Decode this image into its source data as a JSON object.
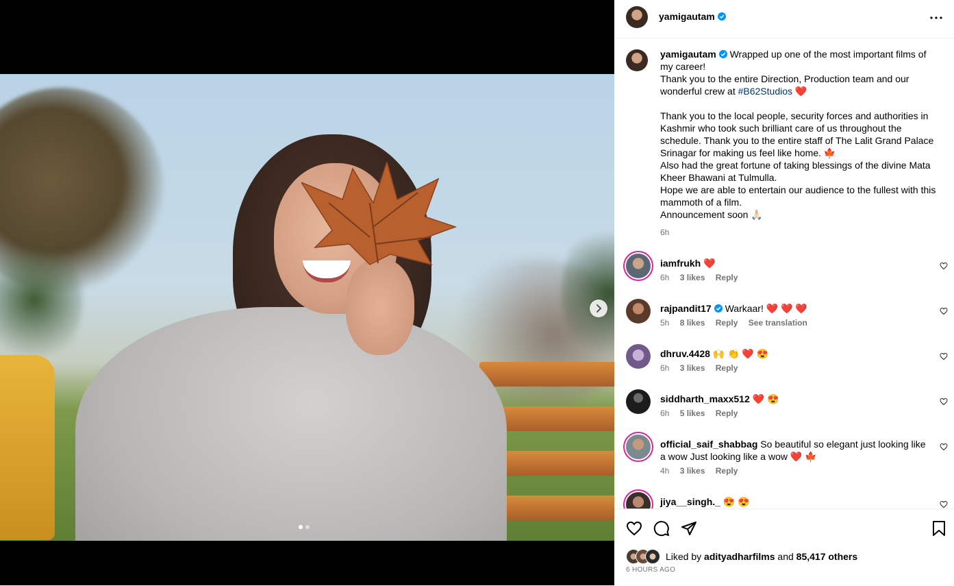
{
  "post": {
    "username": "yamigautam",
    "verified": true
  },
  "caption": {
    "username": "yamigautam",
    "line1": "Wrapped up one of the most important films of my career!",
    "line2a": "Thank you to the entire Direction, Production team and our wonderful crew at",
    "hashtag": "#B62Studios",
    "line2b": " ❤️",
    "para2": "Thank you to the local people, security forces and authorities in Kashmir who took such brilliant care of us throughout the schedule. Thank you to the entire staff of The Lalit Grand Palace Srinagar for making us feel like home. 🍁\nAlso had the great fortune of taking blessings of the divine Mata Kheer Bhawani at Tulmulla.\nHope we are able to entertain our audience to the fullest with this mammoth of a film.\nAnnouncement soon 🙏🏻",
    "age": "6h"
  },
  "comments": [
    {
      "username": "iamfrukh",
      "text": "❤️",
      "age": "6h",
      "likes": "3 likes",
      "reply": "Reply"
    },
    {
      "username": "rajpandit17",
      "text": "Warkaar! ❤️ ❤️ ❤️",
      "age": "5h",
      "likes": "8 likes",
      "reply": "Reply",
      "translate": "See translation"
    },
    {
      "username": "dhruv.4428",
      "text": "🙌 👏 ❤️ 😍",
      "age": "6h",
      "likes": "3 likes",
      "reply": "Reply"
    },
    {
      "username": "siddharth_maxx512",
      "text": "❤️ 😍",
      "age": "6h",
      "likes": "5 likes",
      "reply": "Reply"
    },
    {
      "username": "official_saif_shabbag",
      "text": "So beautiful so elegant just looking like a wow Just looking like a wow ❤️ 🍁",
      "age": "4h",
      "likes": "3 likes",
      "reply": "Reply"
    },
    {
      "username": "jiya__singh._",
      "text": "😍 😍",
      "age": "",
      "likes": "",
      "reply": ""
    }
  ],
  "likes": {
    "prefix": "Liked by ",
    "user": "adityadharfilms",
    "middle": " and ",
    "count": "85,417 others",
    "time": "6 HOURS AGO"
  },
  "icons": {
    "like": "heart-icon",
    "comment": "comment-icon",
    "share": "share-icon",
    "save": "bookmark-icon",
    "more": "more-options-icon",
    "next": "chevron-right-icon"
  },
  "colors": {
    "link": "#00376b",
    "muted": "#737373",
    "verified": "#0095f6",
    "story_ring": "#d6249f"
  }
}
